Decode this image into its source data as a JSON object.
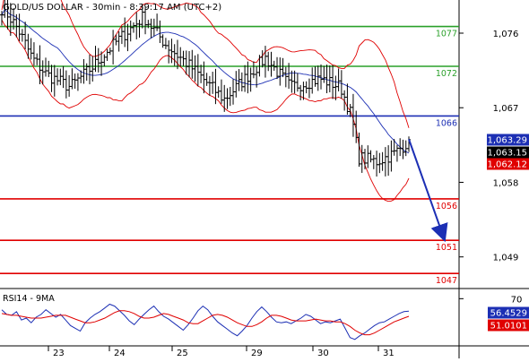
{
  "chart_data": [
    {
      "type": "candlestick",
      "title": "GOLD/US DOLLAR - 30min - 8:39:17 AM (UTC+2)",
      "y_range": [
        1045.4,
        1080.0
      ],
      "y_ticks": [
        1076,
        1067,
        1058,
        1049
      ],
      "x_labels": [
        "23",
        "24",
        "25",
        "29",
        "30",
        "31"
      ],
      "price_path": {
        "x": [
          "23",
          "23",
          "23",
          "23",
          "24",
          "24",
          "24",
          "25",
          "25",
          "25",
          "29",
          "29",
          "29",
          "30",
          "30",
          "30",
          "30",
          "30",
          "31",
          "31"
        ],
        "y": [
          1079.0,
          1076.5,
          1073.0,
          1071.0,
          1069.5,
          1072.0,
          1075.0,
          1078.0,
          1074.5,
          1072.0,
          1068.0,
          1073.0,
          1069.5,
          1070.5,
          1069.5,
          1066.0,
          1061.0,
          1060.5,
          1061.5,
          1063.0
        ]
      },
      "levels": [
        {
          "label": "1077",
          "value": 1076.8,
          "color": "#2aa02a"
        },
        {
          "label": "1072",
          "value": 1072.0,
          "color": "#2aa02a"
        },
        {
          "label": "1066",
          "value": 1066.0,
          "color": "#1c2fb4"
        },
        {
          "label": "1056",
          "value": 1056.0,
          "color": "#e00000"
        },
        {
          "label": "1051",
          "value": 1051.0,
          "color": "#e00000"
        },
        {
          "label": "1047",
          "value": 1047.0,
          "color": "#e00000"
        }
      ],
      "price_badges": [
        {
          "label": "1,063.29",
          "value": 1063.29,
          "bg": "#1c2fb4",
          "fg": "#ffffff"
        },
        {
          "label": "1,063.15",
          "value": 1063.15,
          "bg": "#000000",
          "fg": "#ffffff"
        },
        {
          "label": "1,062.12",
          "value": 1062.12,
          "bg": "#e00000",
          "fg": "#ffffff"
        }
      ],
      "forecast_arrow": {
        "from_value": 1063.2,
        "to_value": 1051.6
      }
    },
    {
      "type": "line",
      "title": "RSI14 - 9MA",
      "y_ticks": [
        70
      ],
      "y_range": [
        20,
        80
      ],
      "series": [
        {
          "name": "RSI14",
          "color": "#1c2fb4",
          "values": [
            58,
            53,
            52,
            56,
            47,
            49,
            44,
            50,
            53,
            58,
            54,
            50,
            53,
            47,
            41,
            38,
            35,
            44,
            49,
            53,
            56,
            60,
            64,
            62,
            57,
            52,
            46,
            42,
            48,
            53,
            58,
            62,
            56,
            51,
            48,
            44,
            40,
            36,
            42,
            49,
            57,
            62,
            58,
            51,
            45,
            41,
            37,
            33,
            30,
            35,
            41,
            49,
            56,
            61,
            56,
            50,
            45,
            44,
            45,
            43,
            46,
            49,
            53,
            51,
            47,
            43,
            45,
            44,
            46,
            48,
            38,
            28,
            26,
            30,
            33,
            37,
            41,
            44,
            45,
            48,
            51,
            54,
            56,
            56.45
          ]
        },
        {
          "name": "9MA",
          "color": "#e00000",
          "values": [
            54,
            53,
            52,
            52,
            51,
            50,
            49,
            49,
            49,
            50,
            51,
            52,
            52,
            52,
            50,
            48,
            46,
            44,
            44,
            45,
            47,
            49,
            52,
            55,
            57,
            57,
            56,
            54,
            51,
            49,
            49,
            50,
            52,
            54,
            53,
            51,
            49,
            47,
            44,
            43,
            43,
            46,
            49,
            52,
            53,
            52,
            50,
            47,
            44,
            42,
            40,
            40,
            42,
            45,
            49,
            52,
            52,
            51,
            49,
            47,
            46,
            46,
            46,
            47,
            48,
            47,
            46,
            46,
            45,
            45,
            43,
            40,
            36,
            33,
            31,
            31,
            33,
            36,
            39,
            42,
            45,
            47,
            49,
            51.01
          ]
        }
      ],
      "value_badges": [
        {
          "label": "56.4529",
          "value": 56.45,
          "bg": "#1c2fb4",
          "fg": "#ffffff"
        },
        {
          "label": "51.0101",
          "value": 51.01,
          "bg": "#e00000",
          "fg": "#ffffff"
        }
      ]
    }
  ],
  "colors": {
    "price_line": "#000000",
    "bollinger": "#e00000",
    "moving_average": "#1c2fb4",
    "arrow": "#1c2fb4",
    "separator": "#000000",
    "axis_text": "#000000"
  }
}
